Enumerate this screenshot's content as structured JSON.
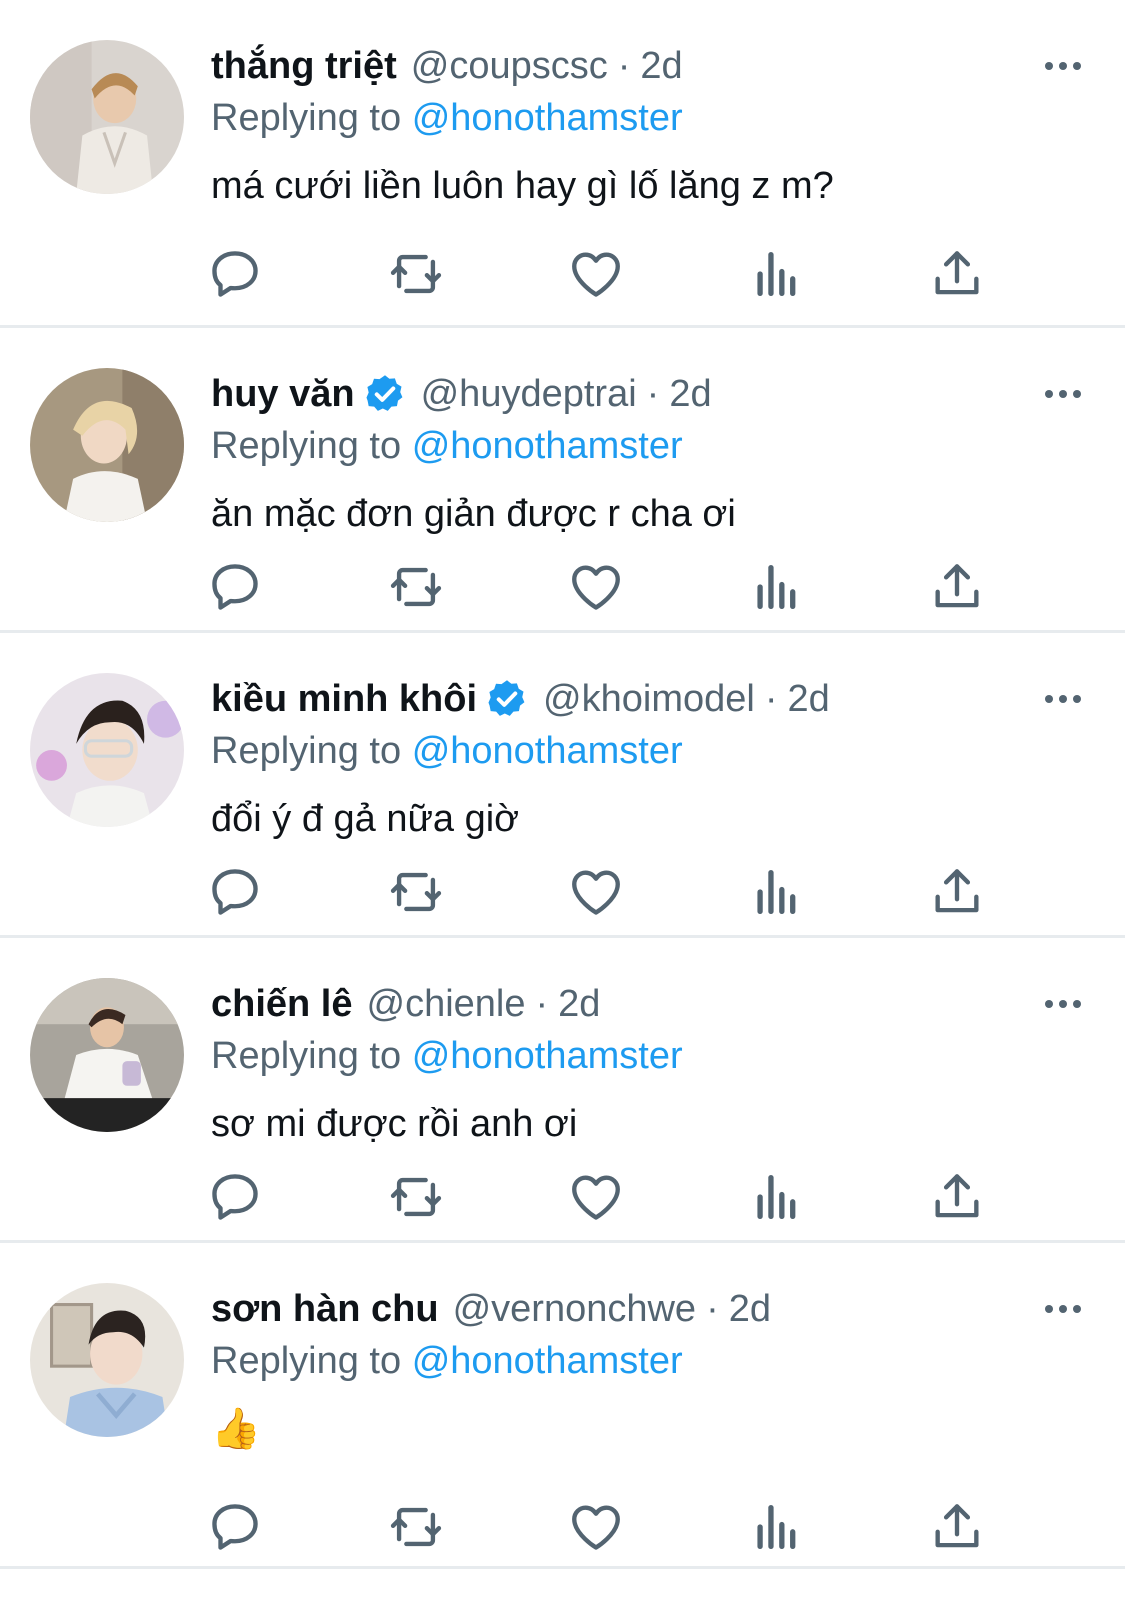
{
  "tweets": [
    {
      "name": "thắng triệt",
      "verified": false,
      "handle": "@coupscsc",
      "separator": "·",
      "time": "2d",
      "replying_label": "Replying to",
      "replying_to": "@honothamster",
      "text": "má cưới liền luôn hay gì lố lăng z m?",
      "avatar_icon": "avatar-photo"
    },
    {
      "name": "huy văn",
      "verified": true,
      "handle": "@huydeptrai",
      "separator": "·",
      "time": "2d",
      "replying_label": "Replying to",
      "replying_to": "@honothamster",
      "text": "ăn mặc đơn giản được r cha ơi",
      "avatar_icon": "avatar-photo"
    },
    {
      "name": "kiều minh khôi",
      "verified": true,
      "handle": "@khoimodel",
      "separator": "·",
      "time": "2d",
      "replying_label": "Replying to",
      "replying_to": "@honothamster",
      "text": "đổi ý đ gả nữa giờ",
      "avatar_icon": "avatar-photo"
    },
    {
      "name": "chiến lê",
      "verified": false,
      "handle": "@chienle",
      "separator": "·",
      "time": "2d",
      "replying_label": "Replying to",
      "replying_to": "@honothamster",
      "text": "sơ mi được rồi anh ơi",
      "avatar_icon": "avatar-photo"
    },
    {
      "name": "sơn hàn chu",
      "verified": false,
      "handle": "@vernonchwe",
      "separator": "·",
      "time": "2d",
      "replying_label": "Replying to",
      "replying_to": "@honothamster",
      "text": "👍",
      "avatar_icon": "avatar-photo"
    }
  ],
  "action_icons": [
    "reply-icon",
    "retweet-icon",
    "like-icon",
    "views-icon",
    "share-icon"
  ],
  "colors": {
    "mention": "#1d9bf0",
    "secondary_text": "#536471",
    "icon": "#536471",
    "verified": "#1d9bf0",
    "divider": "#e7ebee"
  }
}
